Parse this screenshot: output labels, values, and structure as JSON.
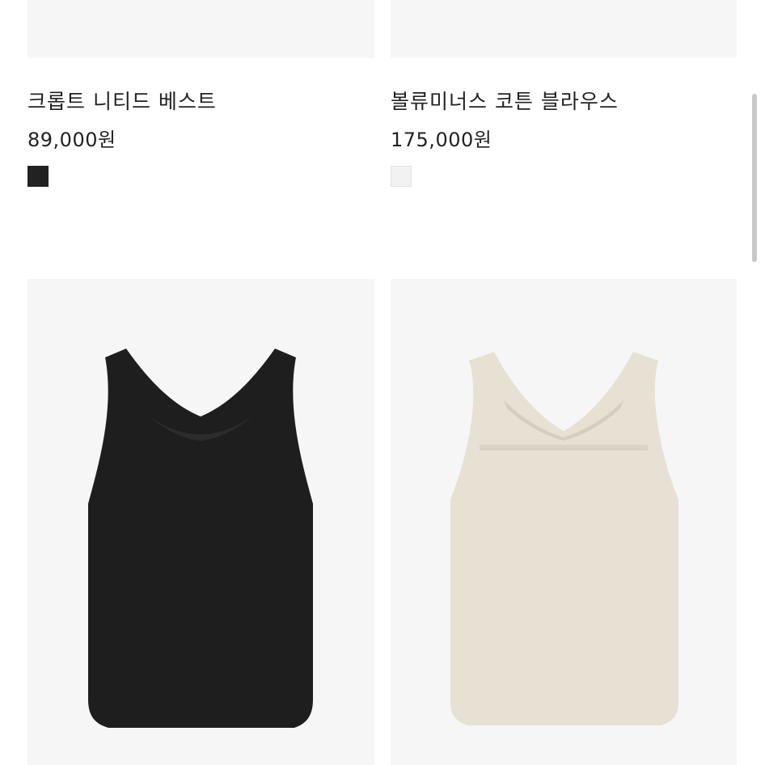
{
  "products": [
    {
      "name": "크롭트 니티드 베스트",
      "price": "89,000원",
      "swatch_color": "#222222",
      "swatch_name": "black"
    },
    {
      "name": "볼류미너스 코튼 블라우스",
      "price": "175,000원",
      "swatch_color": "#f2f2f2",
      "swatch_name": "white"
    }
  ],
  "next_row": [
    {
      "image": "black-cross-back-vest",
      "color": "#1e1e1e"
    },
    {
      "image": "beige-cross-back-vest",
      "color": "#e6e1d3"
    }
  ]
}
